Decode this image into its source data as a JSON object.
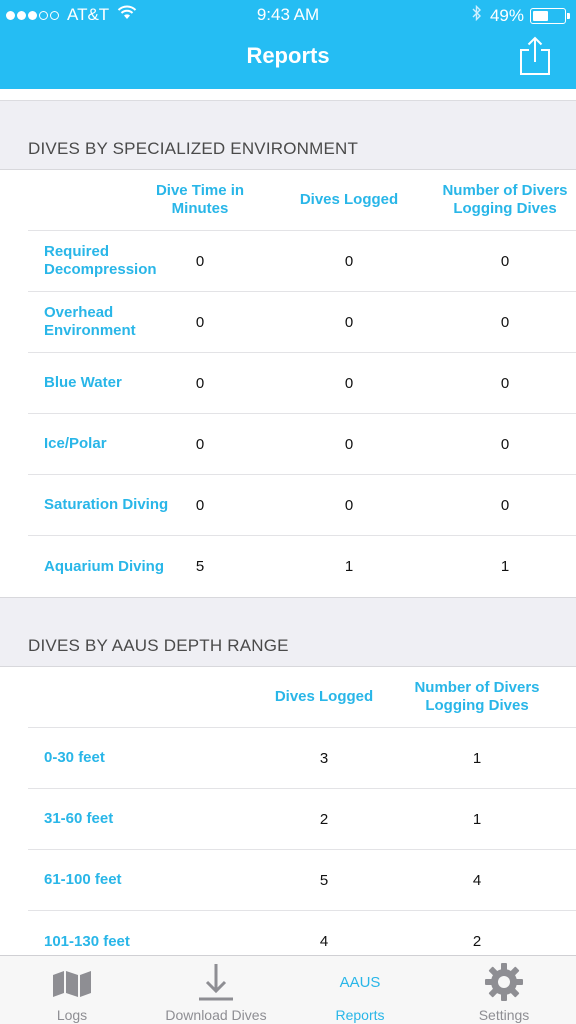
{
  "status_bar": {
    "carrier": "AT&T",
    "time": "9:43 AM",
    "battery": "49%",
    "battery_level": 0.49
  },
  "header": {
    "title": "Reports",
    "share_icon": "share-icon"
  },
  "sections": [
    {
      "title": "DIVES BY SPECIALIZED ENVIRONMENT",
      "columns": [
        "Dive Time in Minutes",
        "Dives Logged",
        "Number of Divers Logging Dives"
      ],
      "rows": [
        {
          "label": "Required Decompression",
          "values": [
            "0",
            "0",
            "0"
          ]
        },
        {
          "label": "Overhead Environment",
          "values": [
            "0",
            "0",
            "0"
          ]
        },
        {
          "label": "Blue Water",
          "values": [
            "0",
            "0",
            "0"
          ]
        },
        {
          "label": "Ice/Polar",
          "values": [
            "0",
            "0",
            "0"
          ]
        },
        {
          "label": "Saturation Diving",
          "values": [
            "0",
            "0",
            "0"
          ]
        },
        {
          "label": "Aquarium Diving",
          "values": [
            "5",
            "1",
            "1"
          ]
        }
      ]
    },
    {
      "title": "DIVES BY AAUS DEPTH RANGE",
      "columns": [
        "Dives Logged",
        "Number of Divers Logging Dives"
      ],
      "rows": [
        {
          "label": "0-30 feet",
          "values": [
            "3",
            "1"
          ]
        },
        {
          "label": "31-60 feet",
          "values": [
            "2",
            "1"
          ]
        },
        {
          "label": "61-100 feet",
          "values": [
            "5",
            "4"
          ]
        },
        {
          "label": "101-130 feet",
          "values": [
            "4",
            "2"
          ]
        }
      ]
    }
  ],
  "tabbar": {
    "tabs": [
      {
        "label": "Logs",
        "icon": "map-icon",
        "active": false
      },
      {
        "label": "Download Dives",
        "icon": "download-icon",
        "active": false
      },
      {
        "label": "Reports",
        "icon": "aaus-icon",
        "icon_text": "AAUS",
        "active": true
      },
      {
        "label": "Settings",
        "icon": "gear-icon",
        "active": false
      }
    ]
  },
  "colors": {
    "accent": "#25bdf3",
    "link": "#29b6e8"
  }
}
